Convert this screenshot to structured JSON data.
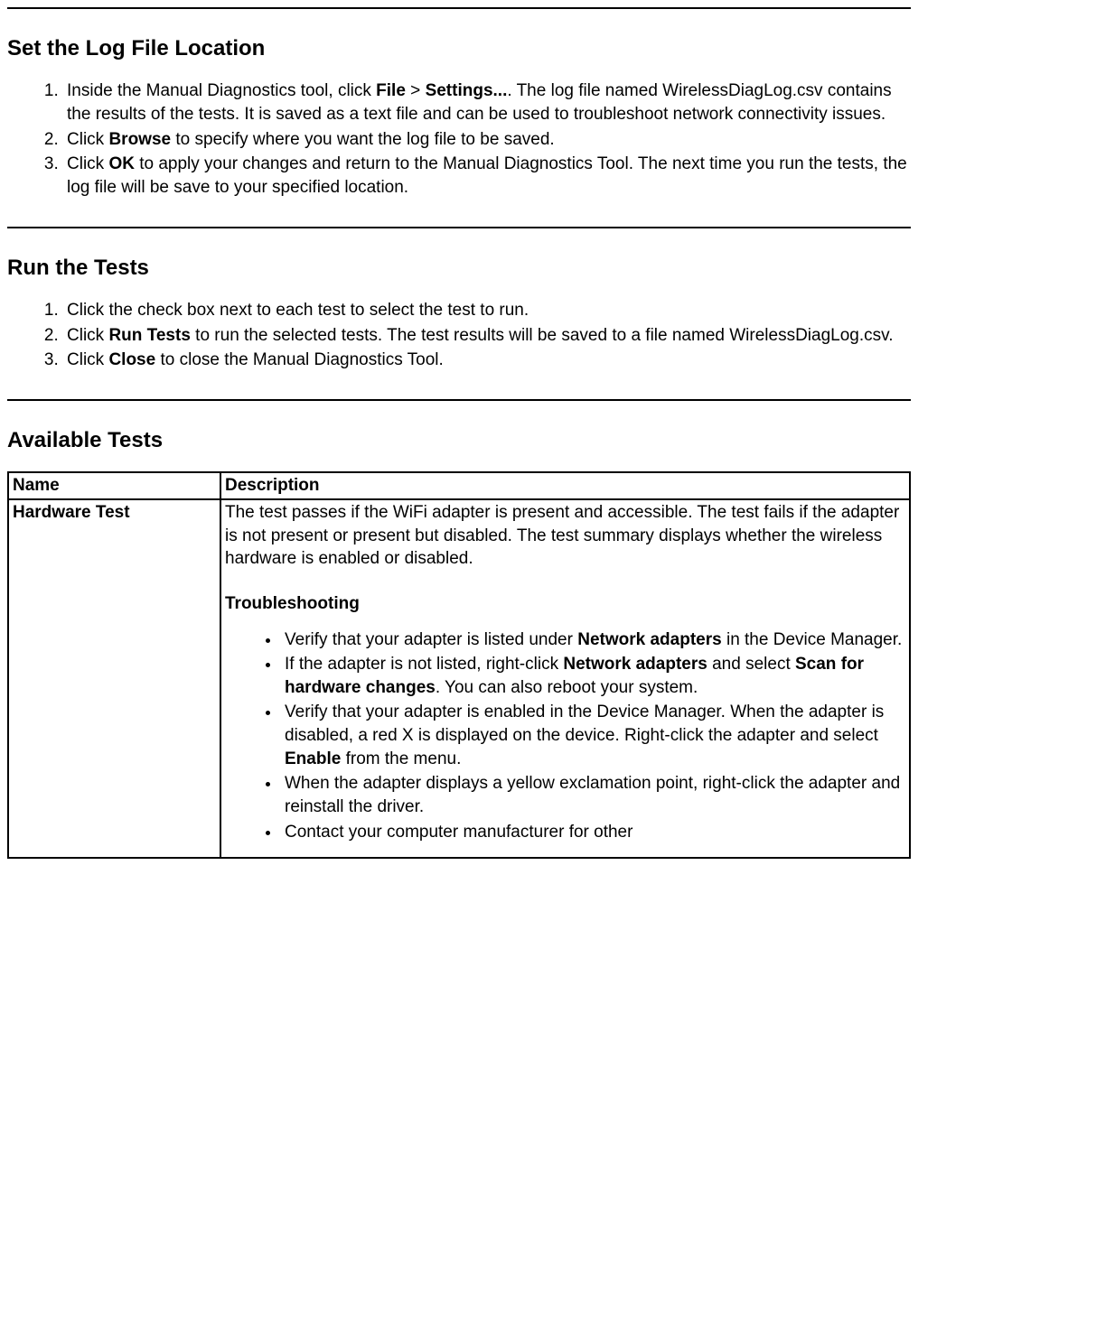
{
  "section1": {
    "heading": "Set the Log File Location",
    "li1_a": "Inside the Manual Diagnostics tool, click ",
    "li1_b1": "File",
    "li1_c": " > ",
    "li1_b2": "Settings...",
    "li1_d": ". The log file named WirelessDiagLog.csv contains the results of the tests. It is saved as a text file and can be used to troubleshoot network connectivity issues.",
    "li2_a": "Click ",
    "li2_b": "Browse",
    "li2_c": " to specify where you want the log file to be saved.",
    "li3_a": "Click ",
    "li3_b": "OK",
    "li3_c": " to apply your changes and return to the Manual Diagnostics Tool. The next time you run the tests, the log file will be save to your specified location."
  },
  "section2": {
    "heading": "Run the Tests",
    "li1": "Click the check box next to each test to select the test to run.",
    "li2_a": "Click ",
    "li2_b": "Run Tests",
    "li2_c": " to run the selected tests. The test results will be saved to a file named WirelessDiagLog.csv.",
    "li3_a": "Click ",
    "li3_b": "Close",
    "li3_c": " to close the Manual Diagnostics Tool."
  },
  "section3": {
    "heading": "Available Tests",
    "table": {
      "header_name": "Name",
      "header_desc": "Description",
      "row1": {
        "name": "Hardware Test",
        "desc_p1": "The test passes if the WiFi adapter is present and accessible. The test fails if the adapter is not present or present but disabled. The test summary displays whether the wireless hardware is enabled or disabled.",
        "sub_heading": "Troubleshooting",
        "b1_a": "Verify that your adapter is listed under ",
        "b1_b": "Network adapters",
        "b1_c": " in the Device Manager.",
        "b2_a": "If the adapter is not listed, right-click ",
        "b2_b": "Network adapters",
        "b2_c": " and select ",
        "b2_d": "Scan for hardware changes",
        "b2_e": ". You can also reboot your system.",
        "b3_a": "Verify that your adapter is enabled in the Device Manager. When the adapter is disabled, a red X is displayed on the device. Right-click the adapter and select ",
        "b3_b": "Enable",
        "b3_c": " from the menu.",
        "b4": "When the adapter displays a yellow exclamation point, right-click the adapter and reinstall the driver.",
        "b5": "Contact your computer manufacturer for other"
      }
    }
  }
}
